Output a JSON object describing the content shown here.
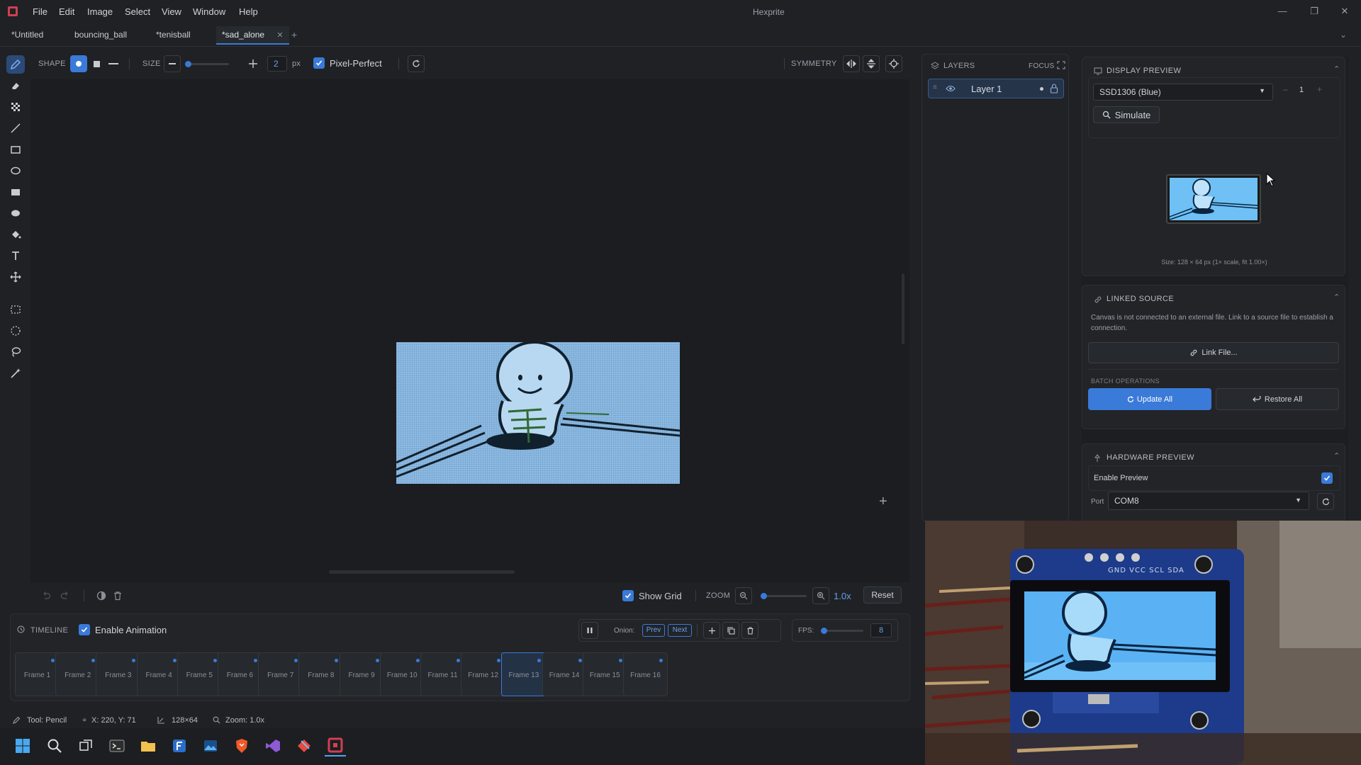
{
  "menu": [
    "File",
    "Edit",
    "Image",
    "Select",
    "View",
    "Window",
    "Help"
  ],
  "app_title": "Hexprite",
  "tabs": [
    "*Untitled",
    "bouncing_ball",
    "*tenisball",
    "*sad_alone"
  ],
  "options": {
    "shape_label": "SHAPE",
    "size_label": "SIZE",
    "size_value": "2",
    "size_unit": "px",
    "pixel_perfect_label": "Pixel-Perfect",
    "pixel_perfect_checked": true,
    "symmetry_label": "SYMMETRY"
  },
  "canvas_bottom": {
    "show_grid_label": "Show Grid",
    "zoom_label": "ZOOM",
    "zoom_value": "1.0x",
    "reset_label": "Reset"
  },
  "timeline": {
    "title": "TIMELINE",
    "enable_label": "Enable Animation",
    "onion_label": "Onion:",
    "prev_label": "Prev",
    "next_label": "Next",
    "fps_label": "FPS:",
    "fps_value": "8",
    "frames": [
      "Frame 1",
      "Frame 2",
      "Frame 3",
      "Frame 4",
      "Frame 5",
      "Frame 6",
      "Frame 7",
      "Frame 8",
      "Frame 9",
      "Frame 10",
      "Frame 11",
      "Frame 12",
      "Frame 13",
      "Frame 14",
      "Frame 15",
      "Frame 16"
    ],
    "active_frame": "Frame 13"
  },
  "status": {
    "tool": "Tool: Pencil",
    "coords": "X: 220, Y: 71",
    "size": "128×64",
    "zoom": "Zoom: 1.0x"
  },
  "layers": {
    "title": "LAYERS",
    "focus_label": "FOCUS",
    "items": [
      "Layer 1"
    ]
  },
  "display_preview": {
    "title": "DISPLAY PREVIEW",
    "device": "SSD1306 (Blue)",
    "scale": "1",
    "simulate_label": "Simulate",
    "size_info": "Size: 128 × 64 px (1× scale, fit 1.00×)"
  },
  "linked_source": {
    "title": "LINKED SOURCE",
    "description": "Canvas is not connected to an external file. Link to a source file to establish a connection.",
    "link_label": "Link File...",
    "batch_title": "BATCH OPERATIONS",
    "update_label": "Update All",
    "restore_label": "Restore All"
  },
  "hardware_preview": {
    "title": "HARDWARE PREVIEW",
    "enable_label": "Enable Preview",
    "port_label": "Port",
    "port_value": "COM8"
  },
  "photo": {
    "pin_labels": "GND VCC SCL SDA"
  },
  "colors": {
    "accent": "#3a7ad8",
    "sprite_bg": "#8ebde6",
    "bg": "#1f2125"
  }
}
